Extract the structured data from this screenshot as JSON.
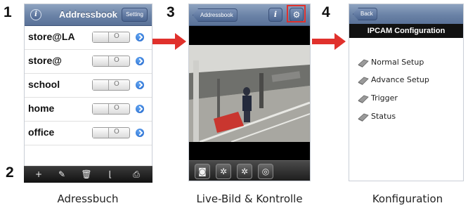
{
  "steps": {
    "s1": "1",
    "s2": "2",
    "s3": "3",
    "s4": "4"
  },
  "captions": {
    "c1": "Adressbuch",
    "c2": "Live-Bild & Kontrolle",
    "c3": "Konfiguration"
  },
  "colors": {
    "arrow": "#e0312c",
    "nav_blue": "#6a82a6",
    "disclosure_blue": "#1f63c9"
  },
  "phone1": {
    "title": "Addressbook",
    "setting_button": "Setting",
    "info_icon": "info-icon",
    "entries": [
      {
        "label": "store@LA",
        "switch": "O"
      },
      {
        "label": "store@",
        "switch": "O"
      },
      {
        "label": "school",
        "switch": "O"
      },
      {
        "label": "home",
        "switch": "O"
      },
      {
        "label": "office",
        "switch": "O"
      }
    ],
    "toolbar": [
      {
        "icon": "add-icon",
        "glyph": "+"
      },
      {
        "icon": "edit-icon",
        "glyph": "✎"
      },
      {
        "icon": "trash-icon",
        "glyph": "🗑"
      },
      {
        "icon": "chart-icon",
        "glyph": "⌊"
      },
      {
        "icon": "export-icon",
        "glyph": "⎙"
      }
    ]
  },
  "phone2": {
    "back_button": "Addressbook",
    "info_icon": "info-icon",
    "settings_icon": "gear-icon",
    "toolbar": [
      {
        "icon": "snapshot-icon",
        "glyph": "◙"
      },
      {
        "icon": "control-icon",
        "glyph": "✲"
      },
      {
        "icon": "ptz-icon",
        "glyph": "✲"
      },
      {
        "icon": "ring-icon",
        "glyph": "◎"
      }
    ]
  },
  "phone3": {
    "back_button": "Back",
    "title": "IPCAM Configuration",
    "items": [
      {
        "label": "Normal Setup",
        "icon": "wrench-icon"
      },
      {
        "label": "Advance Setup",
        "icon": "wrench-icon"
      },
      {
        "label": "Trigger",
        "icon": "wrench-icon"
      },
      {
        "label": "Status",
        "icon": "wrench-icon"
      }
    ]
  }
}
